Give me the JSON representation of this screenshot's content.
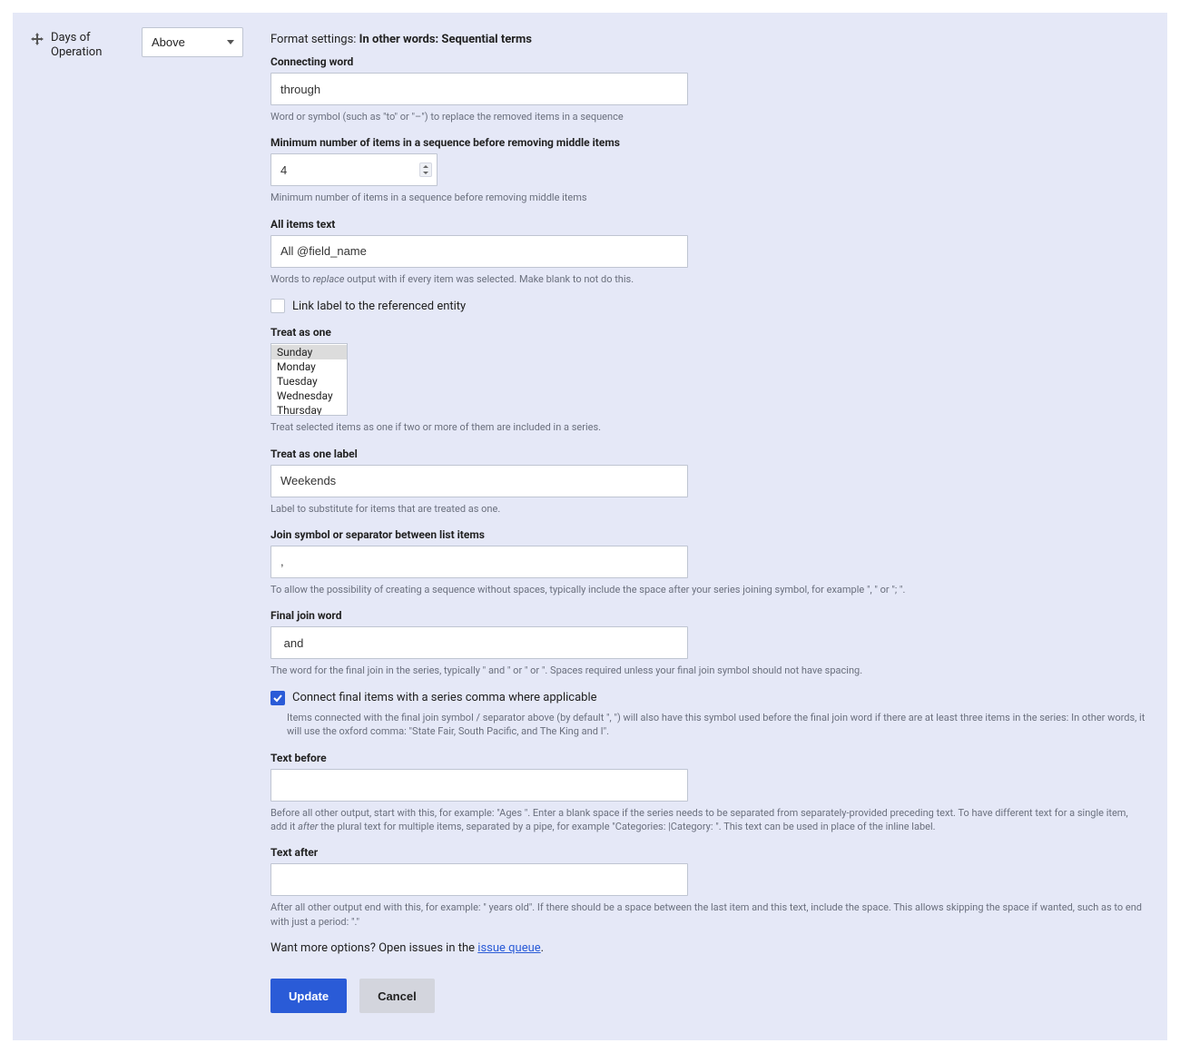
{
  "row": {
    "field_label": "Days of Operation",
    "label_position": "Above"
  },
  "format_settings_prefix": "Format settings:",
  "format_settings_name": "In other words: Sequential terms",
  "connecting_word": {
    "label": "Connecting word",
    "value": "through",
    "help": "Word or symbol (such as \"to\" or \"–\") to replace the removed items in a sequence"
  },
  "min_items": {
    "label": "Minimum number of items in a sequence before removing middle items",
    "value": "4",
    "help": "Minimum number of items in a sequence before removing middle items"
  },
  "all_items": {
    "label": "All items text",
    "value": "All @field_name",
    "help_pre": "Words to ",
    "help_italic": "replace",
    "help_post": " output with if every item was selected. Make blank to not do this."
  },
  "link_label": {
    "label": "Link label to the referenced entity",
    "checked": false
  },
  "treat_as_one": {
    "label": "Treat as one",
    "options": [
      "Sunday",
      "Monday",
      "Tuesday",
      "Wednesday",
      "Thursday"
    ],
    "selected_index": 0,
    "help": "Treat selected items as one if two or more of them are included in a series."
  },
  "treat_as_one_label": {
    "label": "Treat as one label",
    "value": "Weekends",
    "help": "Label to substitute for items that are treated as one."
  },
  "join_symbol": {
    "label": "Join symbol or separator between list items",
    "value": ",",
    "help": "To allow the possibility of creating a sequence without spaces, typically include the space after your series joining symbol, for example \", \" or \"; \"."
  },
  "final_join": {
    "label": "Final join word",
    "value": " and ",
    "help": "The word for the final join in the series, typically \" and \" or \" or \". Spaces required unless your final join symbol should not have spacing."
  },
  "series_comma": {
    "label": "Connect final items with a series comma where applicable",
    "checked": true,
    "help": "Items connected with the final join symbol / separator above (by default \", \") will also have this symbol used before the final join word if there are at least three items in the series: In other words, it will use the oxford comma: \"State Fair, South Pacific, and The King and I\"."
  },
  "text_before": {
    "label": "Text before",
    "value": "",
    "help_pre": "Before all other output, start with this, for example: \"Ages \". Enter a blank space if the series needs to be separated from separately-provided preceding text. To have different text for a single item, add it ",
    "help_italic": "after",
    "help_post": " the plural text for multiple items, separated by a pipe, for example \"Categories: |Category: \". This text can be used in place of the inline label."
  },
  "text_after": {
    "label": "Text after",
    "value": "",
    "help": "After all other output end with this, for example: \" years old\". If there should be a space between the last item and this text, include the space. This allows skipping the space if wanted, such as to end with just a period: \".\""
  },
  "want_more": {
    "text": "Want more options? Open issues in the ",
    "link": "issue queue",
    "suffix": "."
  },
  "buttons": {
    "update": "Update",
    "cancel": "Cancel"
  }
}
